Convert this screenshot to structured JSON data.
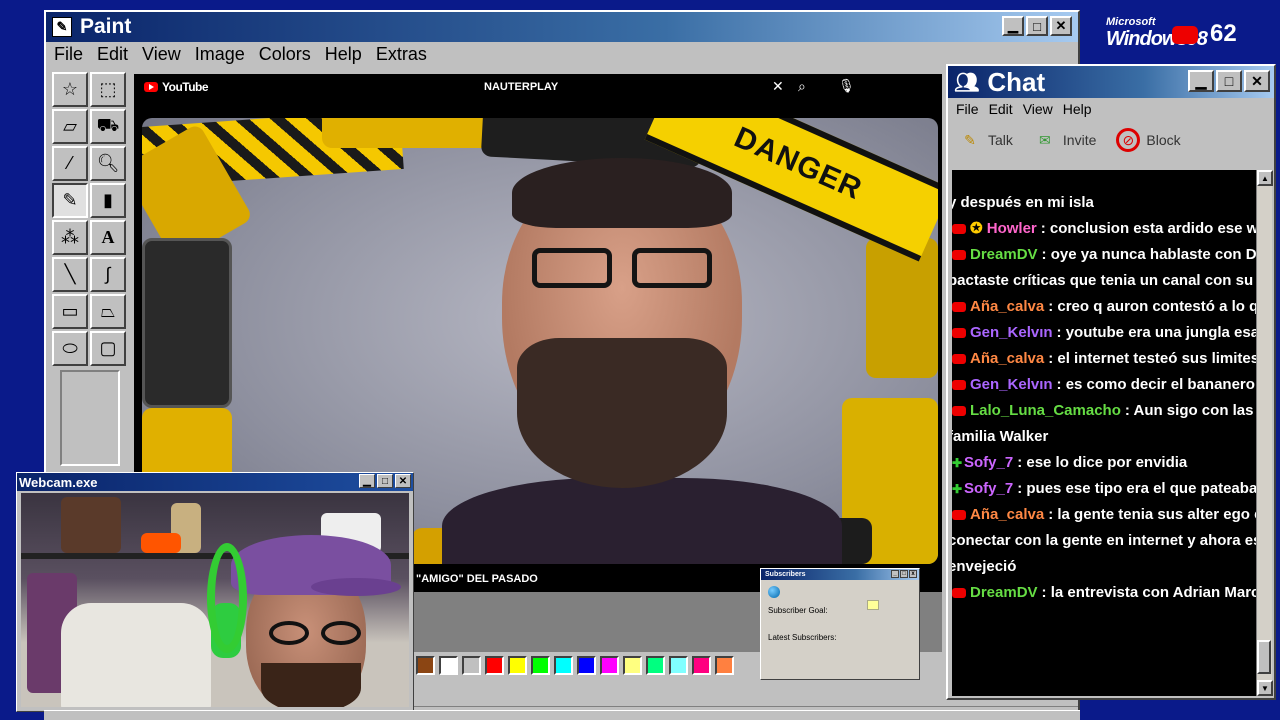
{
  "desktop": {
    "logo_small": "Microsoft",
    "logo_big": "Windows98",
    "badge_number": "62"
  },
  "paint": {
    "title": "Paint",
    "menu": [
      "File",
      "Edit",
      "View",
      "Image",
      "Colors",
      "Help",
      "Extras"
    ],
    "palette": [
      "#8b4513",
      "#ffffff",
      "#c0c0c0",
      "#ff0000",
      "#ffff00",
      "#00ff00",
      "#00ffff",
      "#0000ff",
      "#ff00ff",
      "#ffff80",
      "#00ff80",
      "#80ffff",
      "#ff0080",
      "#ff8040"
    ]
  },
  "youtube": {
    "logo_text": "YouTube",
    "search_text": "NAUTERPLAY",
    "caption": "\"AMIGO\" DEL PASADO",
    "overlay_text": "DANGER"
  },
  "subscribers": {
    "title": "Subscribers",
    "goal_label": "Subscriber Goal:",
    "latest_label": "Latest Subscribers:"
  },
  "webcam": {
    "title": "Webcam.exe"
  },
  "chat": {
    "title": "Chat",
    "menu": [
      "File",
      "Edit",
      "View",
      "Help"
    ],
    "tools": [
      "Talk",
      "Invite",
      "Block"
    ],
    "top_fragment": "y después en mi isla",
    "messages": [
      {
        "name": "Howler",
        "color": "#ff66cc",
        "text": ": conclusion esta ardido ese wey",
        "src": "yt",
        "badge": true
      },
      {
        "name": "DreamDV",
        "color": "#66dd44",
        "text": ": oye ya nunca hablaste con Danny",
        "src": "yt",
        "cont": "pactaste críticas que tenia un canal con su he"
      },
      {
        "name": "Aña_calva",
        "color": "#ff8844",
        "text": ": creo q auron contestó a lo q dijo",
        "src": "yt"
      },
      {
        "name": "Gen_Kelvın",
        "color": "#aa66ff",
        "text": ": youtube era una jungla esa ep",
        "src": "yt"
      },
      {
        "name": "Aña_calva",
        "color": "#ff8844",
        "text": ": el internet testeó sus limites en",
        "src": "yt"
      },
      {
        "name": "Gen_Kelvın",
        "color": "#aa66ff",
        "text": ": es como decir el bananero",
        "src": "yt"
      },
      {
        "name": "Lalo_Luna_Camacho",
        "color": "#66dd44",
        "text": ": Aun sigo con las se",
        "src": "yt",
        "cont": "familia Walker"
      },
      {
        "name": "Sofy_7",
        "color": "#cc66ff",
        "text": ": ese lo dice por envidia",
        "src": "tw"
      },
      {
        "name": "Sofy_7",
        "color": "#cc66ff",
        "text": ": pues ese tipo era el que pateaba",
        "src": "tw"
      },
      {
        "name": "Aña_calva",
        "color": "#ff8844",
        "text": ": la gente tenia sus alter ego en",
        "src": "yt",
        "cont": "conectar con la gente en internet y ahora es to",
        "cont2": "envejeció"
      },
      {
        "name": "DreamDV",
        "color": "#66dd44",
        "text": ": la entrevista con Adrian Marcel",
        "src": "yt"
      }
    ]
  }
}
